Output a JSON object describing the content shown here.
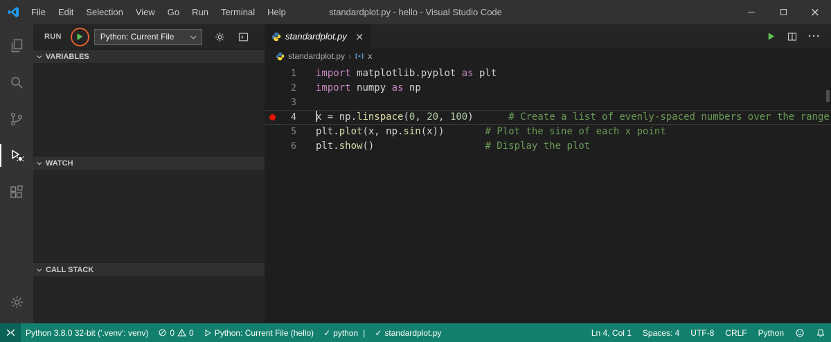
{
  "window": {
    "title": "standardplot.py - hello - Visual Studio Code",
    "menus": [
      "File",
      "Edit",
      "Selection",
      "View",
      "Go",
      "Run",
      "Terminal",
      "Help"
    ]
  },
  "icons": {
    "check": "✓",
    "separator": "|",
    "breadcrumb_sep": "›",
    "window_close": "×",
    "tab_close": "×",
    "ellipsis": "···"
  },
  "colors": {
    "statusbar_background": "#12806C",
    "breakpoint_red": "#E51400",
    "play_green": "#61C554",
    "annotation_ring_orange": "#E25E2E",
    "keyword_pink": "#C586C0",
    "comment_green": "#6A9955",
    "number_green": "#B5CEA8",
    "function_yellow": "#DCDCAA"
  },
  "activity_bar": {
    "items": [
      "explorer",
      "search",
      "source-control",
      "run-and-debug",
      "extensions"
    ],
    "active_item": "run-and-debug",
    "bottom_items": [
      "manage"
    ]
  },
  "sidebar": {
    "toolbar": {
      "label": "RUN",
      "config_label": "Python: Current File"
    },
    "sections": [
      {
        "label": "VARIABLES"
      },
      {
        "label": "WATCH"
      },
      {
        "label": "CALL STACK"
      }
    ]
  },
  "editor": {
    "tab": {
      "label": "standardplot.py"
    },
    "breadcrumb": {
      "file": "standardplot.py",
      "symbol": "x"
    },
    "current_line": 4,
    "breakpoint_line": 4,
    "lines": [
      {
        "num": 1,
        "tokens": [
          {
            "t": "import ",
            "c": "kw"
          },
          {
            "t": "matplotlib.pyplot ",
            "c": "plain"
          },
          {
            "t": "as ",
            "c": "kw"
          },
          {
            "t": "plt",
            "c": "plain"
          }
        ]
      },
      {
        "num": 2,
        "tokens": [
          {
            "t": "import ",
            "c": "kw"
          },
          {
            "t": "numpy ",
            "c": "plain"
          },
          {
            "t": "as ",
            "c": "kw"
          },
          {
            "t": "np",
            "c": "plain"
          }
        ]
      },
      {
        "num": 3,
        "tokens": []
      },
      {
        "num": 4,
        "caret": true,
        "tokens": [
          {
            "t": "x = np.",
            "c": "plain"
          },
          {
            "t": "linspace",
            "c": "fn"
          },
          {
            "t": "(",
            "c": "plain"
          },
          {
            "t": "0",
            "c": "num"
          },
          {
            "t": ", ",
            "c": "plain"
          },
          {
            "t": "20",
            "c": "num"
          },
          {
            "t": ", ",
            "c": "plain"
          },
          {
            "t": "100",
            "c": "num"
          },
          {
            "t": ")      ",
            "c": "plain"
          },
          {
            "t": "# Create a list of evenly-spaced numbers over the range",
            "c": "cm"
          }
        ]
      },
      {
        "num": 5,
        "tokens": [
          {
            "t": "plt.",
            "c": "plain"
          },
          {
            "t": "plot",
            "c": "fn"
          },
          {
            "t": "(x, np.",
            "c": "plain"
          },
          {
            "t": "sin",
            "c": "fn"
          },
          {
            "t": "(x))       ",
            "c": "plain"
          },
          {
            "t": "# Plot the sine of each x point",
            "c": "cm"
          }
        ]
      },
      {
        "num": 6,
        "tokens": [
          {
            "t": "plt.",
            "c": "plain"
          },
          {
            "t": "show",
            "c": "fn"
          },
          {
            "t": "()                   ",
            "c": "plain"
          },
          {
            "t": "# Display the plot",
            "c": "cm"
          }
        ]
      }
    ]
  },
  "statusbar": {
    "interpreter": "Python 3.8.0 32-bit ('.venv': venv)",
    "errors": "0",
    "warnings": "0",
    "debug_config": "Python: Current File (hello)",
    "linter": "python",
    "file_check": "standardplot.py",
    "cursor": "Ln 4, Col 1",
    "indent": "Spaces: 4",
    "encoding": "UTF-8",
    "eol": "CRLF",
    "language": "Python"
  }
}
